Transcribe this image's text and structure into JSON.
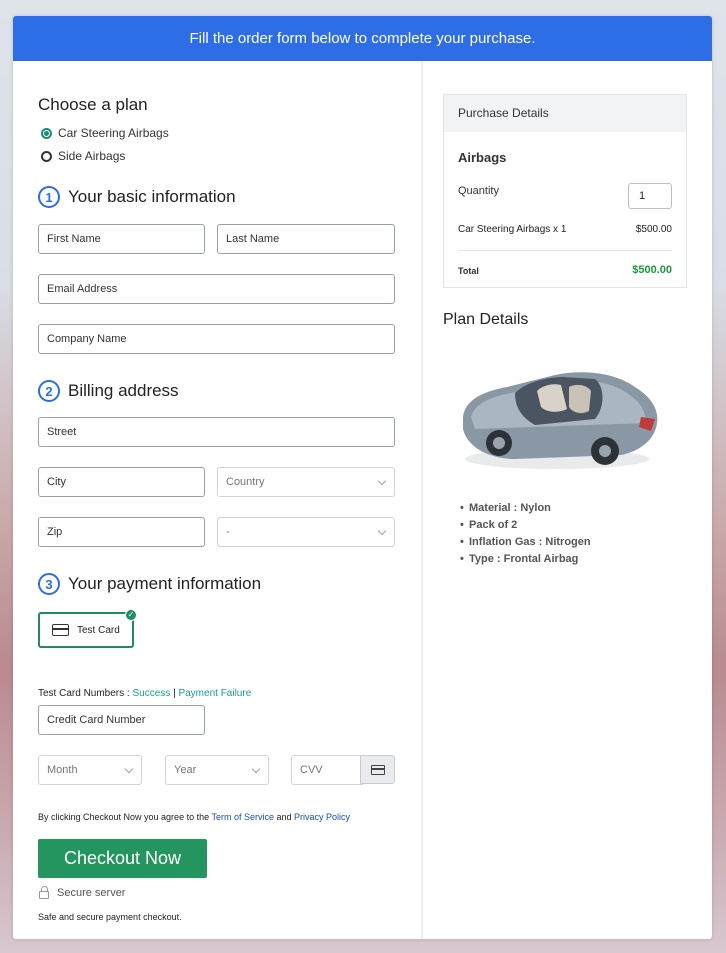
{
  "banner": {
    "text": "Fill the order form below to complete your purchase."
  },
  "plan": {
    "heading": "Choose a plan",
    "options": [
      {
        "label": "Car Steering Airbags",
        "selected": true
      },
      {
        "label": "Side Airbags",
        "selected": false
      }
    ]
  },
  "basic": {
    "number": "1",
    "heading": "Your basic information",
    "first_name": "First Name",
    "last_name": "Last Name",
    "email": "Email Address",
    "company": "Company Name"
  },
  "billing": {
    "number": "2",
    "heading": "Billing address",
    "street": "Street",
    "city": "City",
    "country": "Country",
    "zip": "Zip",
    "state": "-"
  },
  "payment": {
    "number": "3",
    "heading": "Your payment information",
    "card_option": "Test Card",
    "test_prefix": "Test Card Numbers :",
    "success": "Success",
    "separator": "|",
    "failure": "Payment Failure",
    "card_number": "Credit Card Number",
    "month": "Month",
    "year": "Year",
    "cvv": "CVV"
  },
  "terms": {
    "prefix": "By clicking Checkout Now you agree to the",
    "terms_link": "Term of Service",
    "and": "and",
    "privacy_link": "Privacy Policy"
  },
  "checkout": {
    "button": "Checkout Now",
    "secure": "Secure server",
    "safe": "Safe and secure payment checkout."
  },
  "purchase": {
    "heading": "Purchase Details",
    "product": "Airbags",
    "quantity_label": "Quantity",
    "quantity": "1",
    "line_item": "Car Steering Airbags x 1",
    "line_price": "$500.00",
    "total_label": "Total",
    "total": "$500.00"
  },
  "plan_details": {
    "heading": "Plan Details",
    "image_alt": "car-image",
    "features": [
      "Material : Nylon",
      "Pack of 2",
      "Inflation Gas : Nitrogen",
      "Type : Frontal Airbag"
    ]
  },
  "colors": {
    "banner": "#2d6ee6",
    "checkout": "#25955f",
    "total": "#1a9a3a",
    "link": "#1a9a9a"
  }
}
